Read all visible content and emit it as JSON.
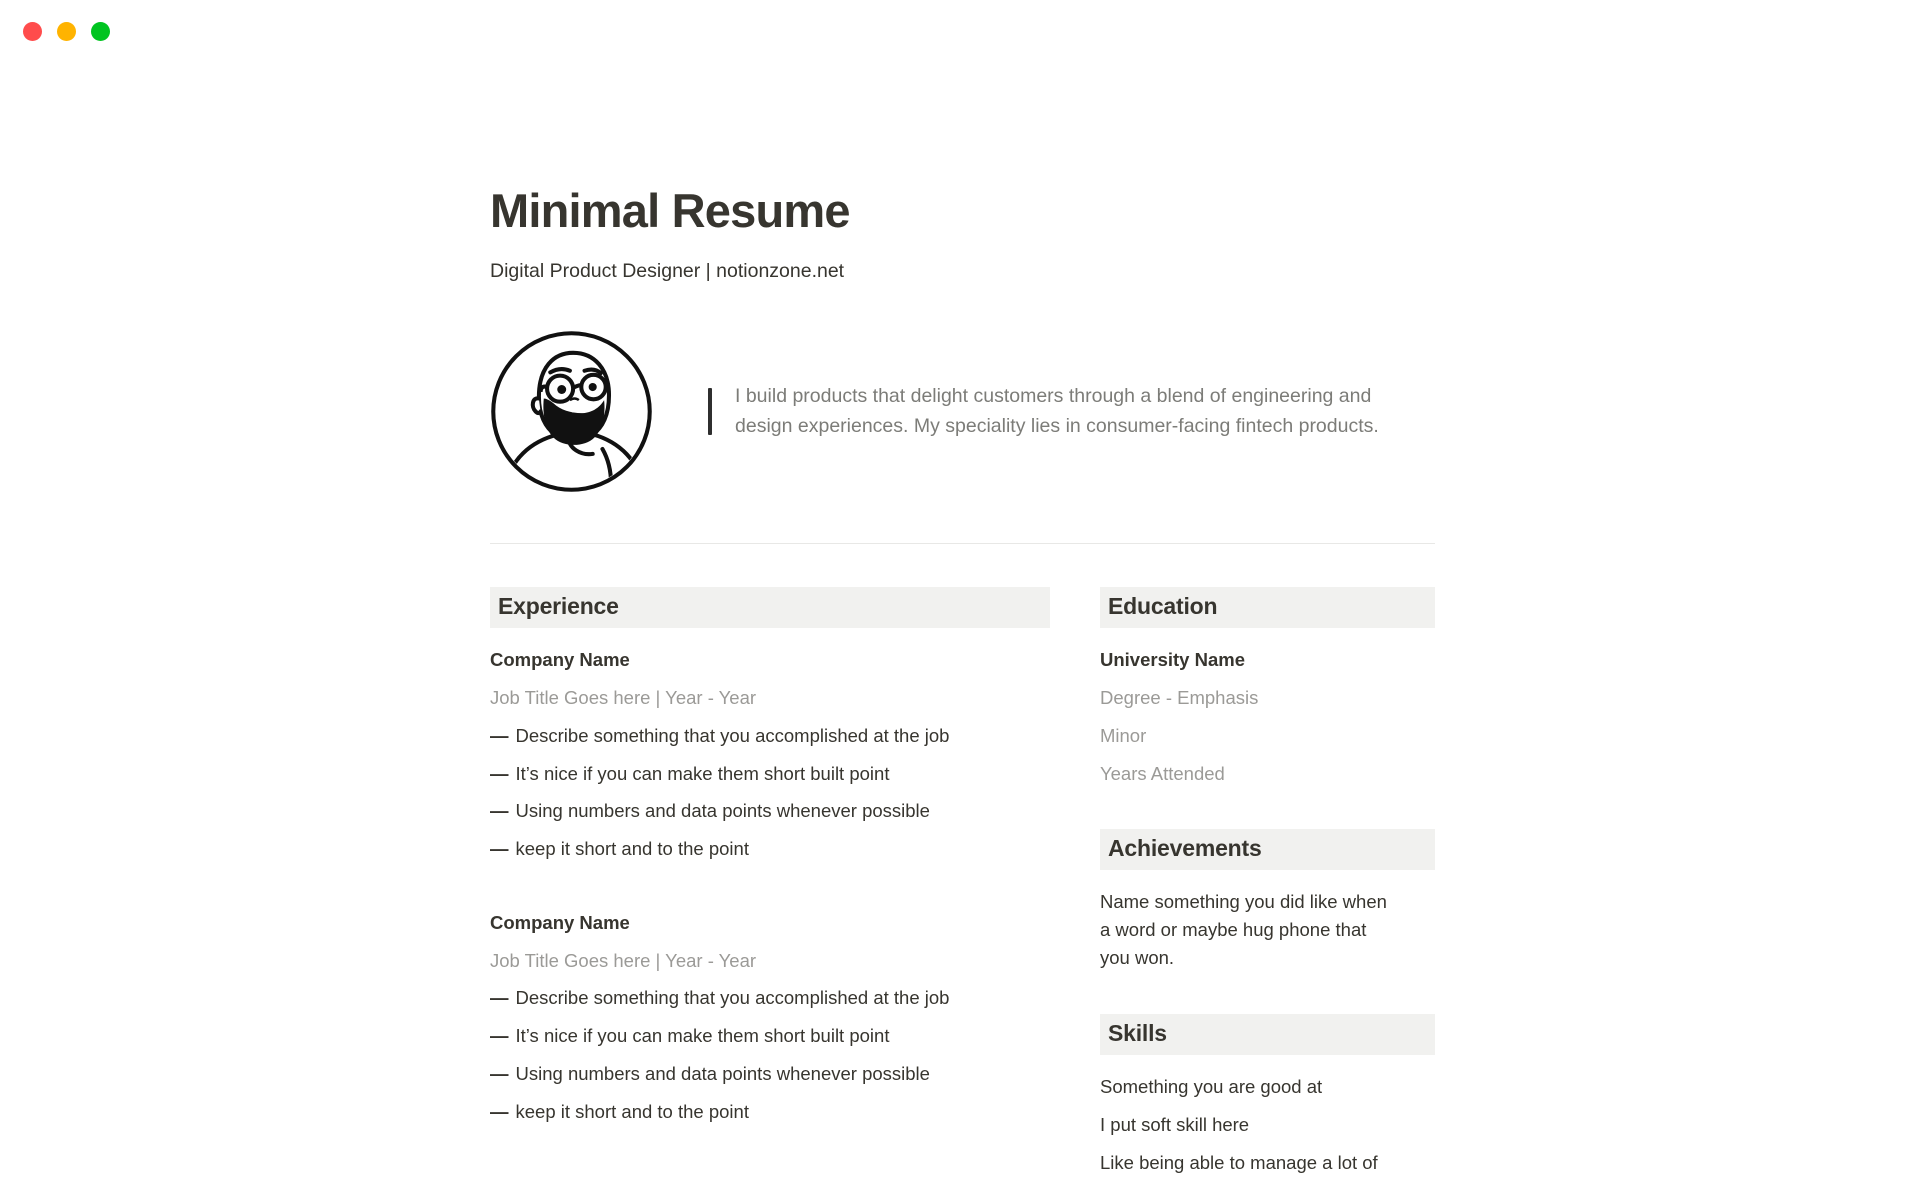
{
  "window": {
    "traffic_lights": [
      {
        "name": "close",
        "color": "#ff4c4c"
      },
      {
        "name": "minimize",
        "color": "#ffb300"
      },
      {
        "name": "maximize",
        "color": "#00c420"
      }
    ]
  },
  "document": {
    "title": "Minimal Resume",
    "subtitle": "Digital Product Designer | notionzone.net",
    "avatar_icon": "bearded-man-with-glasses-avatar",
    "quote": "I build products that delight customers through a blend of engineering and design experiences. My speciality lies in consumer-facing fintech products."
  },
  "left_column": {
    "experience": {
      "heading": "Experience",
      "entries": [
        {
          "company": "Company Name",
          "meta": "Job Title Goes here | Year - Year",
          "bullets": [
            "Describe something that you accomplished at the job",
            "It’s nice if you can make them short built point",
            "Using numbers and data points whenever possible",
            "keep it short and to the point"
          ]
        },
        {
          "company": "Company Name",
          "meta": "Job Title Goes here | Year - Year",
          "bullets": [
            "Describe something that you accomplished at the job",
            "It’s nice if you can make them short built point",
            "Using numbers and data points whenever possible",
            "keep it short and to the point"
          ]
        }
      ],
      "bullet_marker": "—"
    }
  },
  "right_column": {
    "education": {
      "heading": "Education",
      "school": "University Name",
      "degree": "Degree - Emphasis",
      "minor": "Minor",
      "years": "Years Attended"
    },
    "achievements": {
      "heading": "Achievements",
      "body": "Name something you did like when a word or maybe hug phone that you won."
    },
    "skills": {
      "heading": "Skills",
      "items": [
        "Something you are good at",
        "I put soft skill here",
        "Like being able to manage a lot of"
      ]
    }
  }
}
